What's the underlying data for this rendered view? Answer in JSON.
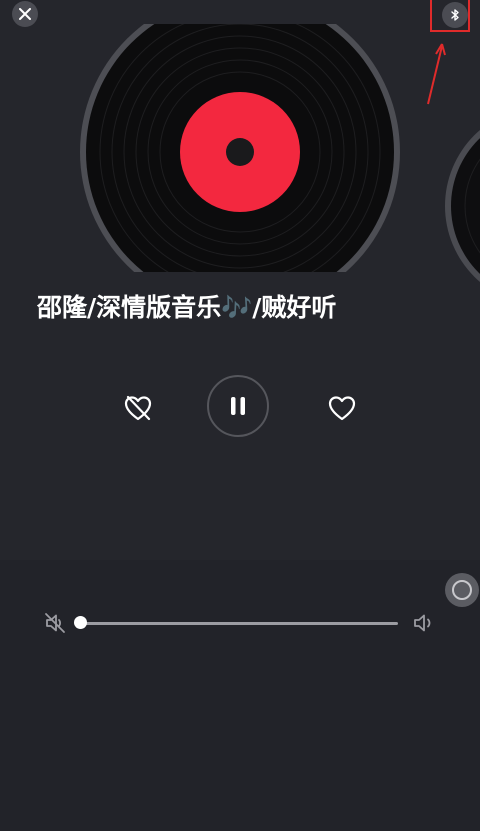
{
  "header": {
    "close_icon": "close-icon",
    "bluetooth_icon": "bluetooth-icon"
  },
  "song": {
    "title": "邵隆/深情版音乐🎶/贼好听"
  },
  "controls": {
    "dislike_icon": "heart-broken-icon",
    "pause_icon": "pause-icon",
    "like_icon": "heart-icon"
  },
  "volume": {
    "level": 0,
    "mute_icon": "volume-mute-icon",
    "max_icon": "volume-icon"
  },
  "colors": {
    "background": "#25262c",
    "record_label": "#f3283f",
    "annotation": "#e02b2b"
  }
}
